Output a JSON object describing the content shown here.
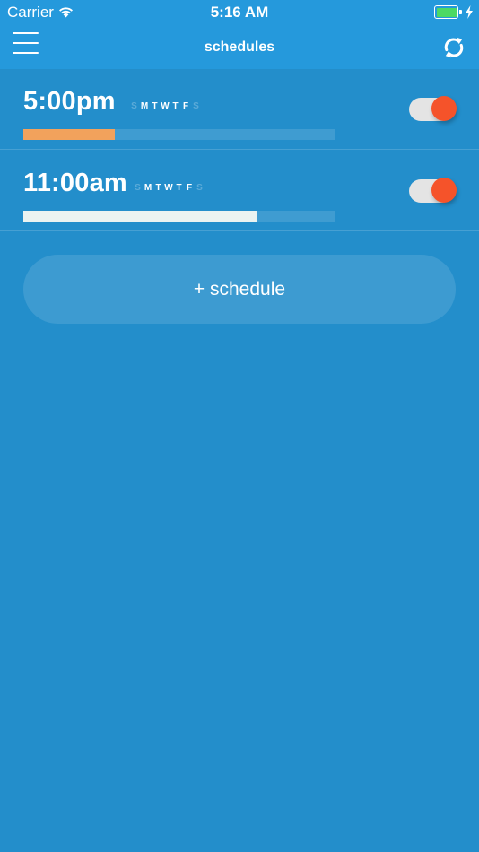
{
  "status_bar": {
    "carrier": "Carrier",
    "time": "5:16 AM",
    "battery_color": "#4cd964",
    "icons": [
      "wifi-icon",
      "battery-icon",
      "charging-bolt-icon"
    ]
  },
  "nav": {
    "title": "schedules",
    "menu_icon": "hamburger-menu-icon",
    "refresh_icon": "refresh-icon"
  },
  "schedules": [
    {
      "time": "5:00pm",
      "days": [
        {
          "letter": "S",
          "active": false
        },
        {
          "letter": "M",
          "active": true
        },
        {
          "letter": "T",
          "active": true
        },
        {
          "letter": "W",
          "active": true
        },
        {
          "letter": "T",
          "active": true
        },
        {
          "letter": "F",
          "active": true
        },
        {
          "letter": "S",
          "active": false
        }
      ],
      "progress": 0.294,
      "progress_color": "#f2a25c",
      "enabled": true
    },
    {
      "time": "11:00am",
      "days": [
        {
          "letter": "S",
          "active": false
        },
        {
          "letter": "M",
          "active": true
        },
        {
          "letter": "T",
          "active": true
        },
        {
          "letter": "W",
          "active": true
        },
        {
          "letter": "T",
          "active": true
        },
        {
          "letter": "F",
          "active": true
        },
        {
          "letter": "S",
          "active": false
        }
      ],
      "progress": 0.752,
      "progress_color": "#ebf3f1",
      "enabled": true
    }
  ],
  "add_button": {
    "label": "+ schedule"
  },
  "colors": {
    "background": "#238ecb",
    "header": "#2599dc",
    "toggle_knob": "#f5532a",
    "toggle_track": "#e4e4e4"
  }
}
